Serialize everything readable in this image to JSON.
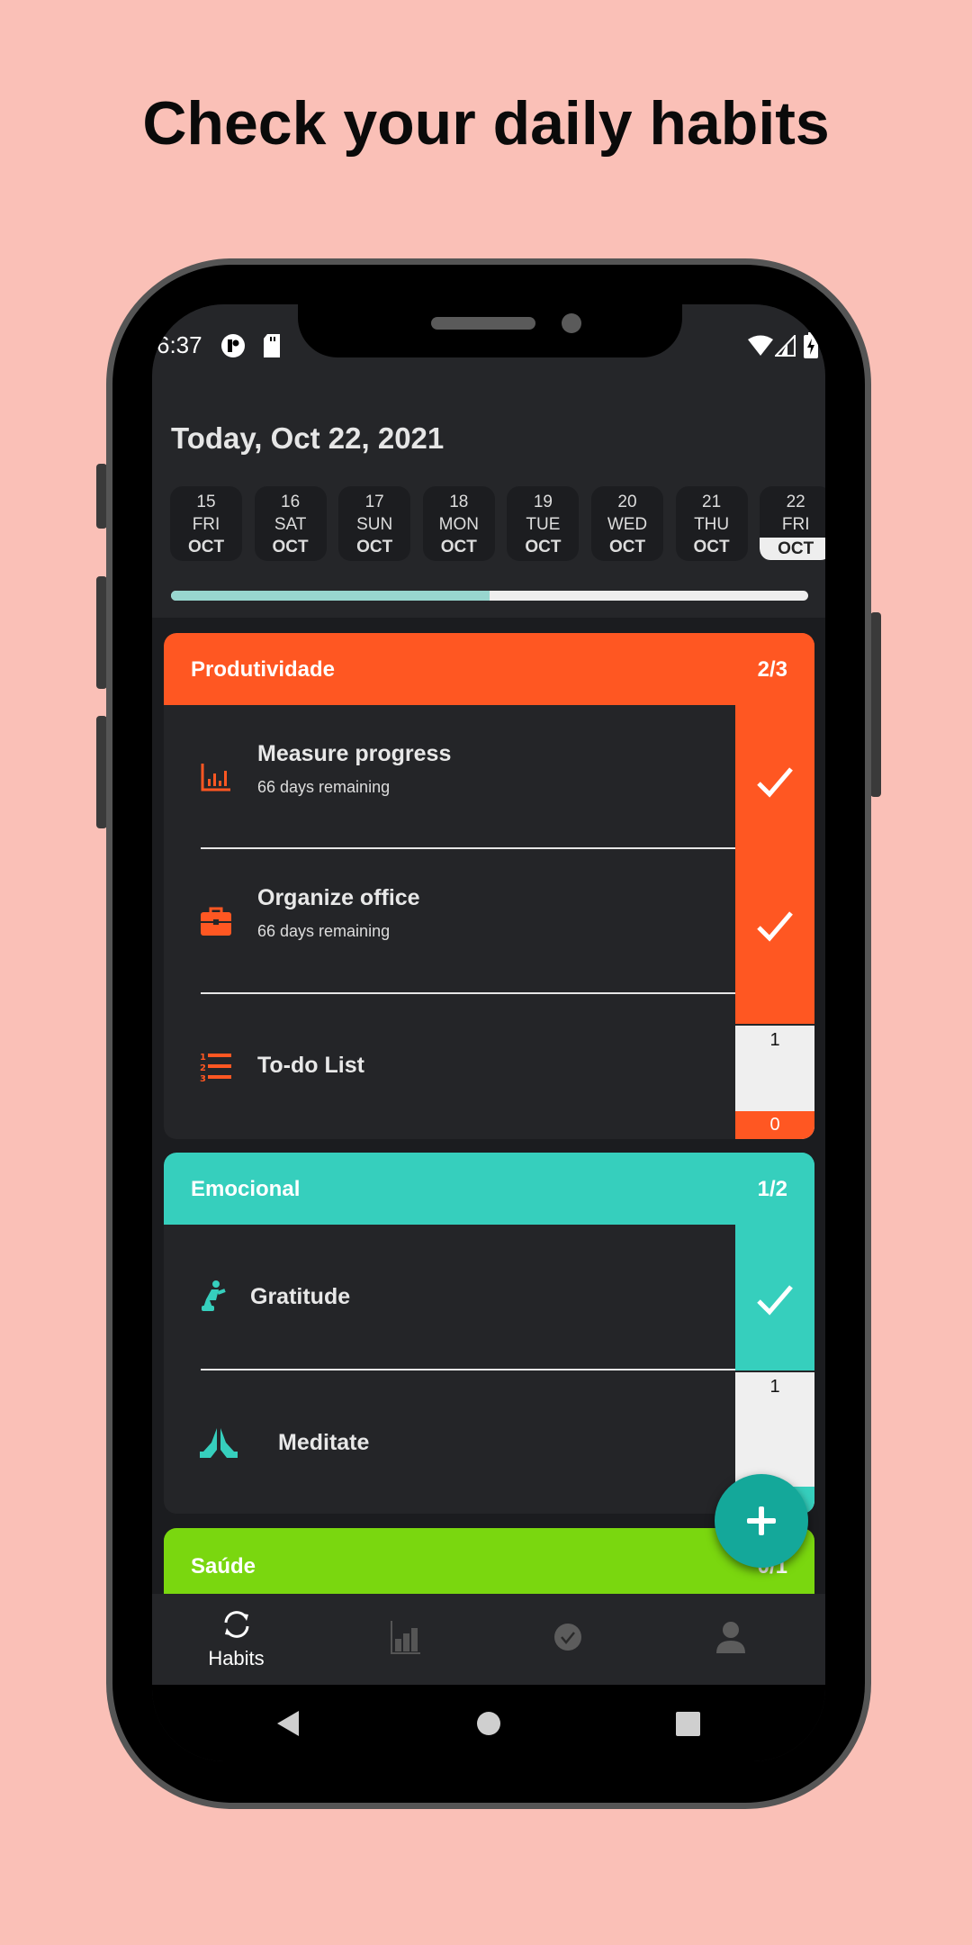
{
  "headline": "Check your daily habits",
  "status_bar": {
    "time": "6:37",
    "icons": [
      "pocket-casts-icon",
      "sd-card-icon",
      "wifi-icon",
      "signal-icon",
      "battery-charging-icon"
    ]
  },
  "header": {
    "title": "Today, Oct 22, 2021"
  },
  "dates": [
    {
      "day": "15",
      "weekday": "FRI",
      "month": "OCT"
    },
    {
      "day": "16",
      "weekday": "SAT",
      "month": "OCT"
    },
    {
      "day": "17",
      "weekday": "SUN",
      "month": "OCT"
    },
    {
      "day": "18",
      "weekday": "MON",
      "month": "OCT"
    },
    {
      "day": "19",
      "weekday": "TUE",
      "month": "OCT"
    },
    {
      "day": "20",
      "weekday": "WED",
      "month": "OCT"
    },
    {
      "day": "21",
      "weekday": "THU",
      "month": "OCT"
    },
    {
      "day": "22",
      "weekday": "FRI",
      "month": "OCT",
      "selected": true
    }
  ],
  "daily_progress_percent": 50,
  "colors": {
    "produtividade": "#FF5722",
    "emocional": "#36CFBD",
    "saude": "#7AD70F",
    "fab": "#14A89A",
    "progress": "#98D6CF"
  },
  "groups": [
    {
      "name": "Produtividade",
      "count": "2/3",
      "habits": [
        {
          "title": "Measure progress",
          "subtitle": "66 days remaining",
          "icon": "bar-chart-icon",
          "done": true
        },
        {
          "title": "Organize office",
          "subtitle": "66 days remaining",
          "icon": "briefcase-icon",
          "done": true
        },
        {
          "title": "To-do List",
          "icon": "numbered-list-icon",
          "done": false,
          "target": "1",
          "current": "0"
        }
      ]
    },
    {
      "name": "Emocional",
      "count": "1/2",
      "habits": [
        {
          "title": "Gratitude",
          "icon": "kneeling-person-icon",
          "done": true
        },
        {
          "title": "Meditate",
          "icon": "praying-hands-icon",
          "done": false,
          "target": "1"
        }
      ]
    },
    {
      "name": "Saúde",
      "count": "0/1"
    }
  ],
  "bottom_nav": [
    {
      "label": "Habits",
      "icon": "sync-icon",
      "active": true
    },
    {
      "icon": "stats-icon"
    },
    {
      "icon": "check-circle-icon"
    },
    {
      "icon": "profile-icon"
    }
  ]
}
